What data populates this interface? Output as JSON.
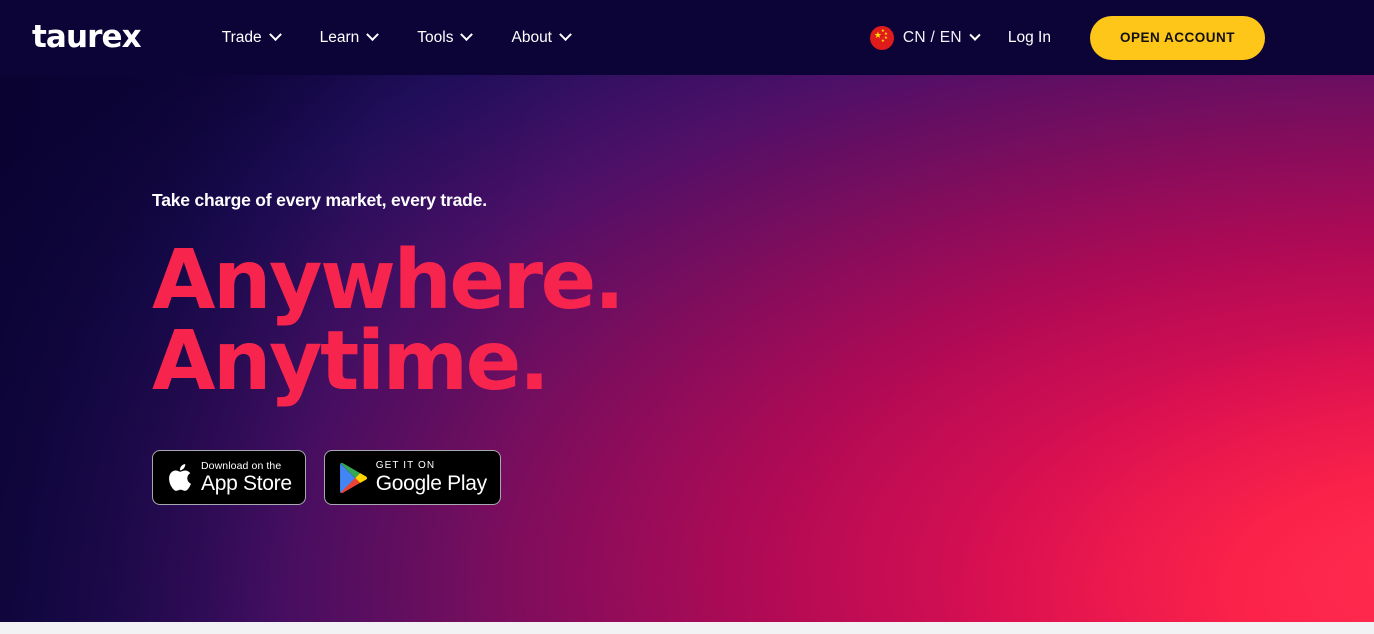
{
  "brand": {
    "logo_text": "taurex",
    "accent_red": "#f7254e",
    "accent_yellow": "#ffc61a",
    "header_bg": "#0c0336"
  },
  "header": {
    "nav_items": [
      {
        "label": "Trade",
        "icon": "chevron-down-icon"
      },
      {
        "label": "Learn",
        "icon": "chevron-down-icon"
      },
      {
        "label": "Tools",
        "icon": "chevron-down-icon"
      },
      {
        "label": "About",
        "icon": "chevron-down-icon"
      }
    ],
    "language": {
      "label": "CN / EN",
      "flag_icon": "china-flag-icon",
      "chevron_icon": "chevron-down-icon"
    },
    "login_label": "Log In",
    "cta_label": "OPEN ACCOUNT"
  },
  "hero": {
    "eyebrow": "Take charge of every market, every trade.",
    "headline_line1": "Anywhere.",
    "headline_line2": "Anytime.",
    "badges": [
      {
        "icon": "apple-logo-icon",
        "small_text": "Download on the",
        "big_text": "App Store"
      },
      {
        "icon": "google-play-icon",
        "small_text": "GET IT ON",
        "big_text": "Google Play"
      }
    ]
  }
}
